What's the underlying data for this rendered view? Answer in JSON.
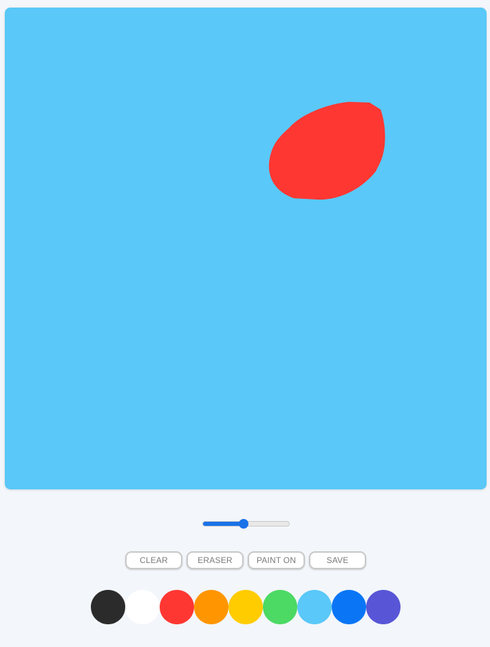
{
  "canvas": {
    "background_color": "#5ac8f8",
    "strokes": [
      {
        "shape": "blob",
        "color": "#ff3732"
      }
    ]
  },
  "brush_size_slider": {
    "value_fraction": 0.47
  },
  "toolbar": {
    "clear_label": "CLEAR",
    "eraser_label": "ERASER",
    "paint_on_label": "PAINT ON",
    "save_label": "SAVE"
  },
  "palette": {
    "colors": [
      {
        "name": "black",
        "hex": "#2b2b2b"
      },
      {
        "name": "white",
        "hex": "#ffffff"
      },
      {
        "name": "red",
        "hex": "#ff3732"
      },
      {
        "name": "orange",
        "hex": "#ff9500"
      },
      {
        "name": "yellow",
        "hex": "#ffcc00"
      },
      {
        "name": "green",
        "hex": "#4cd964"
      },
      {
        "name": "light-blue",
        "hex": "#5ac8f8"
      },
      {
        "name": "blue",
        "hex": "#0a76f6"
      },
      {
        "name": "purple",
        "hex": "#5856d6"
      }
    ]
  }
}
